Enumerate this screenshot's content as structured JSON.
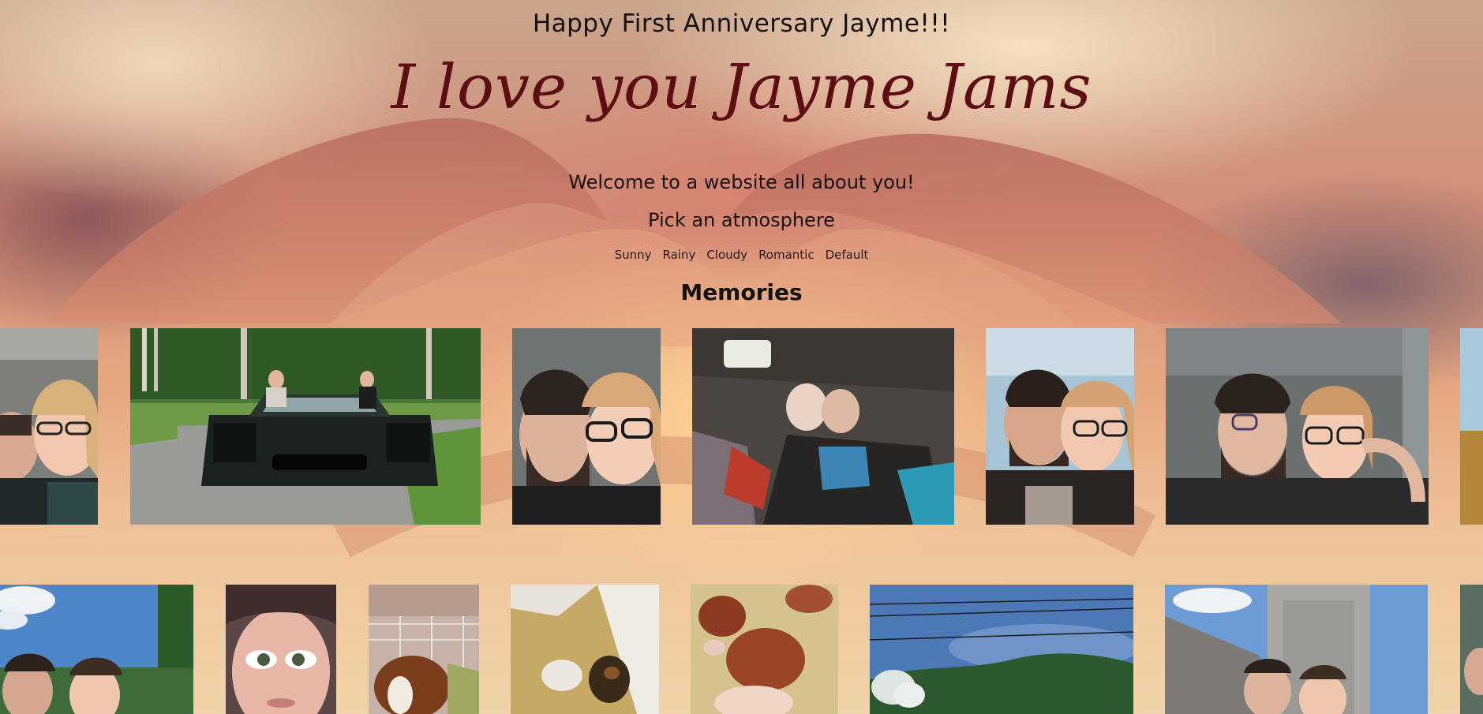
{
  "header": {
    "anniversary": "Happy First Anniversary Jayme!!!",
    "love_title": "I love you Jayme Jams",
    "welcome": "Welcome to a website all about you!",
    "pick_prompt": "Pick an atmosphere"
  },
  "atmospheres": [
    "Sunny",
    "Rainy",
    "Cloudy",
    "Romantic",
    "Default"
  ],
  "section_title": "Memories",
  "photos": {
    "row1": [
      "car-selfie-couple-photo",
      "mustang-car-photo",
      "couple-selfie-photo",
      "car-ceiling-selfie-photo",
      "couple-kiss-photo",
      "car-seat-couple-photo",
      "edge-photo"
    ],
    "row2": [
      "lake-couple-photo",
      "face-closeup-photo",
      "guinea-pig-photo",
      "guinea-pig-bedding-photo",
      "guinea-pig-held-photo",
      "blue-sky-trees-photo",
      "dam-tower-couple-photo",
      "edge-photo-2"
    ]
  },
  "colors": {
    "title_red": "#5e0d12",
    "text_dark": "#151010",
    "background_warm": "#efc39a"
  }
}
